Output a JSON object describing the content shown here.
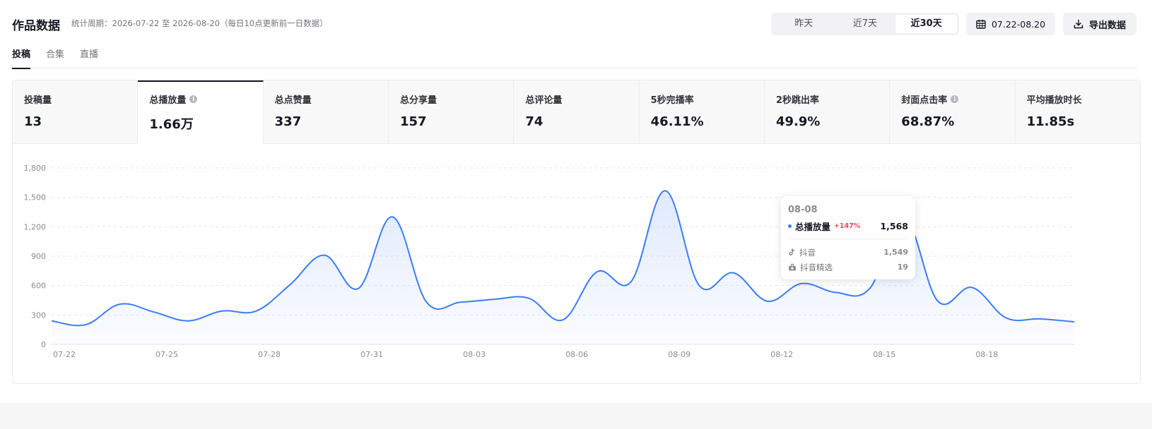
{
  "header": {
    "title": "作品数据",
    "period": "统计周期：2026-07-22 至 2026-08-20（每日10点更新前一日数据）",
    "ranges": [
      "昨天",
      "近7天",
      "近30天"
    ],
    "active_range": "近30天",
    "date_range": "07.22-08.20",
    "export_label": "导出数据"
  },
  "tabs": [
    "投稿",
    "合集",
    "直播"
  ],
  "active_tab": "投稿",
  "metrics": [
    {
      "label": "投稿量",
      "value": "13",
      "info": false
    },
    {
      "label": "总播放量",
      "value": "1.66万",
      "info": true
    },
    {
      "label": "总点赞量",
      "value": "337",
      "info": false
    },
    {
      "label": "总分享量",
      "value": "157",
      "info": false
    },
    {
      "label": "总评论量",
      "value": "74",
      "info": false
    },
    {
      "label": "5秒完播率",
      "value": "46.11%",
      "info": false
    },
    {
      "label": "2秒跳出率",
      "value": "49.9%",
      "info": false
    },
    {
      "label": "封面点击率",
      "value": "68.87%",
      "info": true
    },
    {
      "label": "平均播放时长",
      "value": "11.85s",
      "info": false
    }
  ],
  "active_metric": "总播放量",
  "tooltip": {
    "date": "08-08",
    "series": "总播放量",
    "change": "+147%",
    "value": "1,568",
    "breakdown": [
      {
        "label": "抖音",
        "value": "1,549",
        "icon": "douyin-icon"
      },
      {
        "label": "抖音精选",
        "value": "19",
        "icon": "douyin-featured-icon"
      }
    ]
  },
  "colors": {
    "accent": "#3a7cf7",
    "change_positive": "#f2455e",
    "active_tab": "#161823"
  },
  "chart_data": {
    "type": "area",
    "x": [
      "07-22",
      "07-23",
      "07-24",
      "07-25",
      "07-26",
      "07-27",
      "07-28",
      "07-29",
      "07-30",
      "07-31",
      "08-01",
      "08-02",
      "08-03",
      "08-04",
      "08-05",
      "08-06",
      "08-07",
      "08-08",
      "08-09",
      "08-10",
      "08-11",
      "08-12",
      "08-13",
      "08-14",
      "08-15",
      "08-16",
      "08-17",
      "08-18",
      "08-19",
      "08-20"
    ],
    "x_tick_labels": [
      "07-22",
      "07-25",
      "07-28",
      "07-31",
      "08-03",
      "08-06",
      "08-09",
      "08-12",
      "08-15",
      "08-18"
    ],
    "series": [
      {
        "name": "总播放量",
        "values": [
          240,
          200,
          410,
          330,
          240,
          340,
          340,
          610,
          910,
          570,
          1300,
          430,
          430,
          460,
          470,
          250,
          740,
          640,
          1568,
          600,
          730,
          440,
          620,
          530,
          570,
          1300,
          440,
          580,
          270,
          260,
          230
        ]
      }
    ],
    "y_ticks": [
      "0",
      "300",
      "600",
      "900",
      "1,200",
      "1,500",
      "1,800"
    ],
    "ylim": [
      0,
      1800
    ],
    "grid": true,
    "highlighted_point": "08-08"
  }
}
